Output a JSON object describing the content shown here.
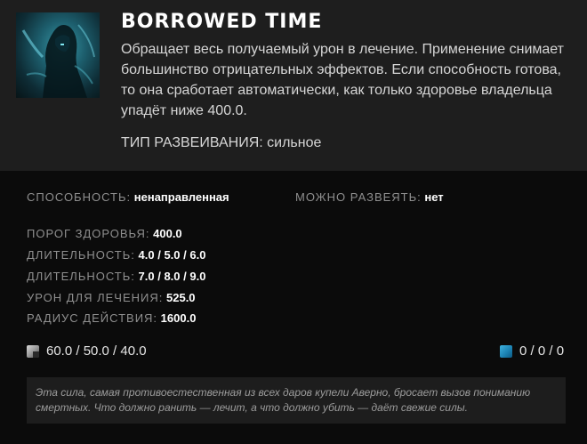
{
  "ability": {
    "title": "BORROWED TIME",
    "description": "Обращает весь получаемый урон в лечение. Применение снимает большинство отрицательных эффектов. Если способность готова, то она сработает автоматически, как только здоровье владельца упадёт ниже 400.0.",
    "dispel_type": "ТИП РАЗВЕИВАНИЯ: сильное",
    "icon": "abaddon-borrowed-time-icon"
  },
  "properties": {
    "ability_label": "СПОСОБНОСТЬ:",
    "ability_value": "ненаправленная",
    "dispellable_label": "МОЖНО РАЗВЕЯТЬ:",
    "dispellable_value": "нет"
  },
  "stats": [
    {
      "label": "ПОРОГ ЗДОРОВЬЯ:",
      "value": "400.0"
    },
    {
      "label": "ДЛИТЕЛЬНОСТЬ:",
      "value": "4.0 / 5.0 / 6.0"
    },
    {
      "label": "ДЛИТЕЛЬНОСТЬ:",
      "value": "7.0 / 8.0 / 9.0"
    },
    {
      "label": "УРОН ДЛЯ ЛЕЧЕНИЯ:",
      "value": "525.0"
    },
    {
      "label": "РАДИУС ДЕЙСТВИЯ:",
      "value": "1600.0"
    }
  ],
  "costs": {
    "cooldown": "60.0 / 50.0 / 40.0",
    "cooldown_icon": "cooldown-icon",
    "mana": "0 / 0 / 0",
    "mana_icon": "mana-icon"
  },
  "lore": "Эта сила, самая противоестественная из всех даров купели Аверно, бросает вызов пониманию смертных. Что должно ранить — лечит, а что должно убить — даёт свежие силы.",
  "colors": {
    "header_bg": "#1e1e1e",
    "body_bg": "#0b0b0b",
    "lore_bg": "#1d1d1d",
    "label": "#8f8f8f",
    "value": "#ffffff",
    "mana": "#1a7fb0"
  }
}
